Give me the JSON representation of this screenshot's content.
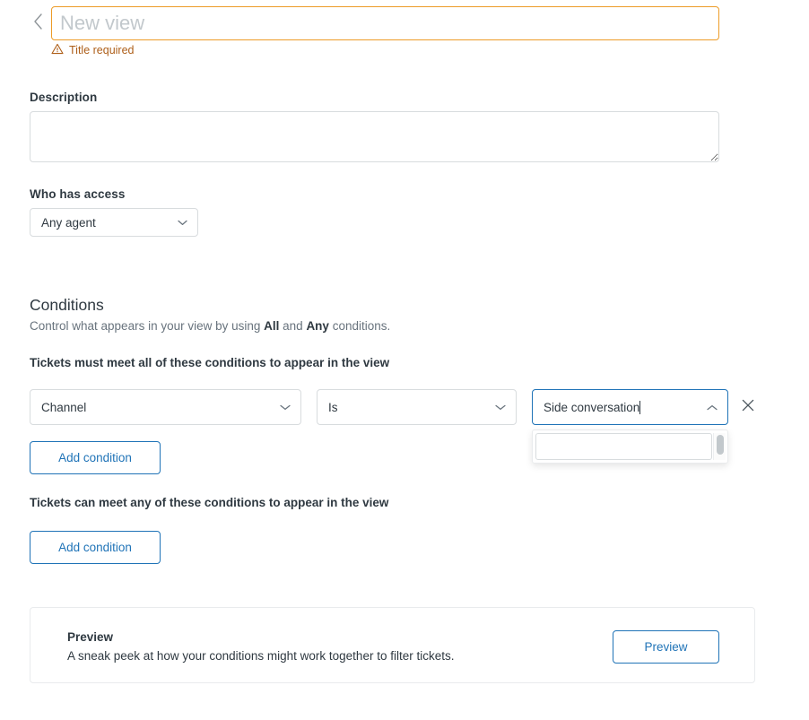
{
  "header": {
    "back_icon": "chevron-left-icon",
    "title_value": "",
    "title_placeholder": "New view",
    "error_text": "Title required",
    "error_icon": "warning-triangle-icon",
    "error_color": "#ad5e18",
    "input_border_color": "#ed9c28"
  },
  "description": {
    "label": "Description",
    "value": "",
    "placeholder": ""
  },
  "access": {
    "label": "Who has access",
    "selected": "Any agent",
    "chevron_icon": "chevron-down-icon"
  },
  "conditions": {
    "title": "Conditions",
    "subtitle_pre": "Control what appears in your view by using ",
    "subtitle_all": "All",
    "subtitle_mid": " and ",
    "subtitle_any": "Any",
    "subtitle_post": " conditions.",
    "all_heading": "Tickets must meet all of these conditions to appear in the view",
    "any_heading": "Tickets can meet any of these conditions to appear in the view",
    "row": {
      "field_select": "Channel",
      "operator_select": "Is",
      "value_combo": "Side conversation",
      "value_combo_open": true,
      "collapse_icon": "chevron-up-icon",
      "remove_icon": "close-icon",
      "dropdown_options": []
    },
    "add_condition_all_label": "Add condition",
    "add_condition_any_label": "Add condition",
    "accent_color": "#1f73b7"
  },
  "preview": {
    "heading": "Preview",
    "description": "A sneak peek at how your conditions might work together to filter tickets.",
    "button_label": "Preview"
  }
}
